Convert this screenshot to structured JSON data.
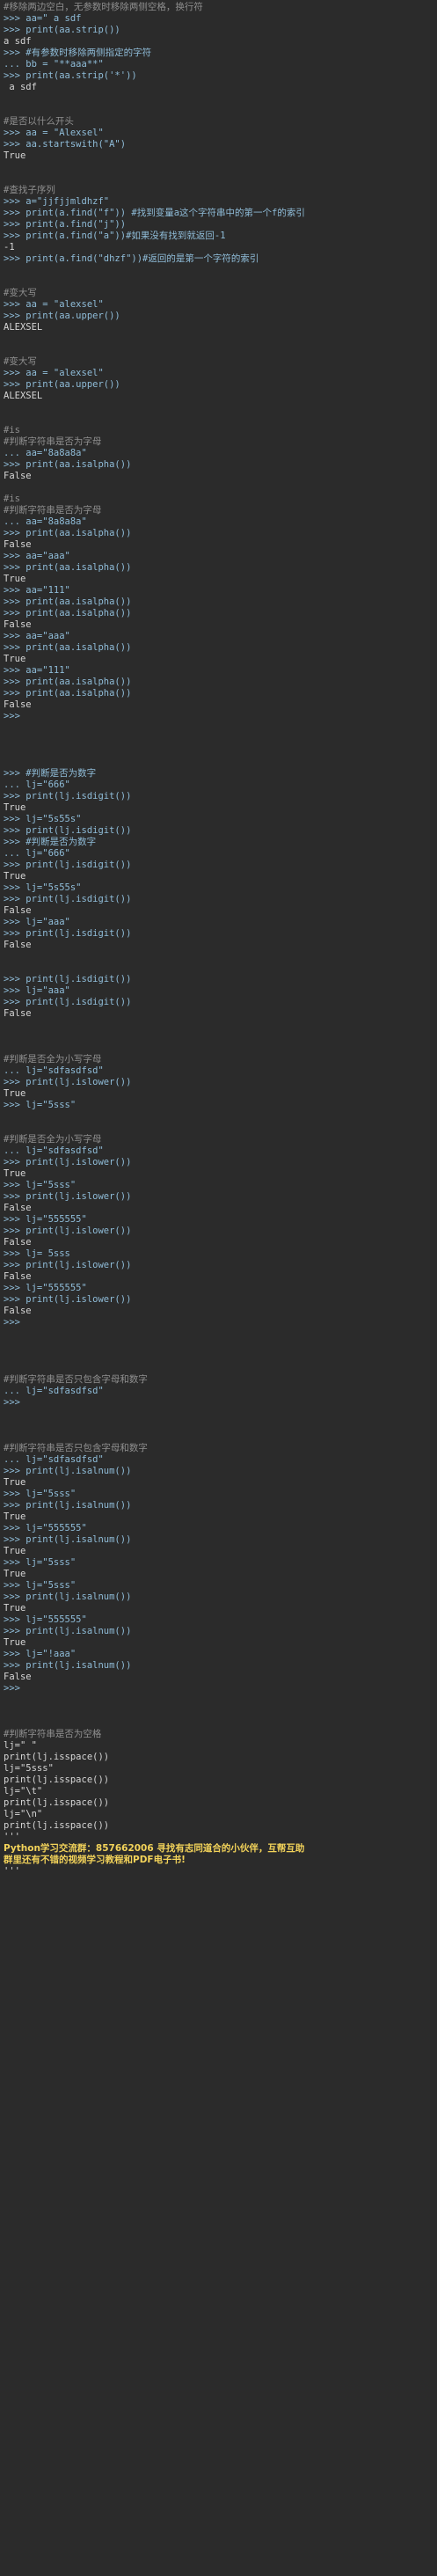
{
  "console_lines": [
    "#移除两边空白，无参数时移除两侧空格，换行符",
    ">>> aa=\" a sdf",
    ">>> print(aa.strip())",
    "a sdf",
    ">>> #有参数时移除两侧指定的字符",
    "... bb = \"**aaa**\"",
    ">>> print(aa.strip('*'))",
    " a sdf",
    "",
    "",
    "#是否以什么开头",
    ">>> aa = \"Alexsel\"",
    ">>> aa.startswith(\"A\")",
    "True",
    "",
    "",
    "#查找子序列",
    ">>> a=\"jjfjjmldhzf\"",
    ">>> print(a.find(\"f\")) #找到变量a这个字符串中的第一个f的索引",
    ">>> print(a.find(\"j\"))",
    ">>> print(a.find(\"a\"))#如果没有找到就返回-1",
    "-1",
    ">>> print(a.find(\"dhzf\"))#返回的是第一个字符的索引",
    "",
    "",
    "#变大写",
    ">>> aa = \"alexsel\"",
    ">>> print(aa.upper())",
    "ALEXSEL",
    "",
    "",
    "#变大写",
    ">>> aa = \"alexsel\"",
    ">>> print(aa.upper())",
    "ALEXSEL",
    "",
    "",
    "#is",
    "#判断字符串是否为字母",
    "... aa=\"8a8a8a\"",
    ">>> print(aa.isalpha())",
    "False",
    "",
    "#is",
    "#判断字符串是否为字母",
    "... aa=\"8a8a8a\"",
    ">>> print(aa.isalpha())",
    "False",
    ">>> aa=\"aaa\"",
    ">>> print(aa.isalpha())",
    "True",
    ">>> aa=\"111\"",
    ">>> print(aa.isalpha())",
    ">>> print(aa.isalpha())",
    "False",
    ">>> aa=\"aaa\"",
    ">>> print(aa.isalpha())",
    "True",
    ">>> aa=\"111\"",
    ">>> print(aa.isalpha())",
    ">>> print(aa.isalpha())",
    "False",
    ">>>",
    "",
    "",
    "",
    "",
    ">>> #判断是否为数字",
    "... lj=\"666\"",
    ">>> print(lj.isdigit())",
    "True",
    ">>> lj=\"5s55s\"",
    ">>> print(lj.isdigit())",
    ">>> #判断是否为数字",
    "... lj=\"666\"",
    ">>> print(lj.isdigit())",
    "True",
    ">>> lj=\"5s55s\"",
    ">>> print(lj.isdigit())",
    "False",
    ">>> lj=\"aaa\"",
    ">>> print(lj.isdigit())",
    "False",
    "",
    "",
    ">>> print(lj.isdigit())",
    ">>> lj=\"aaa\"",
    ">>> print(lj.isdigit())",
    "False",
    "",
    "",
    "",
    "#判断是否全为小写字母",
    "... lj=\"sdfasdfsd\"",
    ">>> print(lj.islower())",
    "True",
    ">>> lj=\"5sss\"",
    "",
    "",
    "#判断是否全为小写字母",
    "... lj=\"sdfasdfsd\"",
    ">>> print(lj.islower())",
    "True",
    ">>> lj=\"5sss\"",
    ">>> print(lj.islower())",
    "False",
    ">>> lj=\"555555\"",
    ">>> print(lj.islower())",
    "False",
    ">>> lj= 5sss",
    ">>> print(lj.islower())",
    "False",
    ">>> lj=\"555555\"",
    ">>> print(lj.islower())",
    "False",
    ">>>",
    "",
    "",
    "",
    "",
    "#判断字符串是否只包含字母和数字",
    "... lj=\"sdfasdfsd\"",
    ">>>",
    "",
    "",
    "",
    "#判断字符串是否只包含字母和数字",
    "... lj=\"sdfasdfsd\"",
    ">>> print(lj.isalnum())",
    "True",
    ">>> lj=\"5sss\"",
    ">>> print(lj.isalnum())",
    "True",
    ">>> lj=\"555555\"",
    ">>> print(lj.isalnum())",
    "True",
    ">>> lj=\"5sss\"",
    "True",
    ">>> lj=\"5sss\"",
    ">>> print(lj.isalnum())",
    "True",
    ">>> lj=\"555555\"",
    ">>> print(lj.isalnum())",
    "True",
    ">>> lj=\"!aaa\"",
    ">>> print(lj.isalnum())",
    "False",
    ">>>",
    "",
    "",
    "",
    "#判断字符串是否为空格",
    "lj=\" \"",
    "print(lj.isspace())",
    "lj=\"5sss\"",
    "print(lj.isspace())",
    "lj=\"\\t\"",
    "print(lj.isspace())",
    "lj=\"\\n\"",
    "print(lj.isspace())",
    "'''",
    "Python学习交流群：857662006 寻找有志同道合的小伙伴，互帮互助",
    "群里还有不错的视频学习教程和PDF电子书!",
    "'''"
  ]
}
